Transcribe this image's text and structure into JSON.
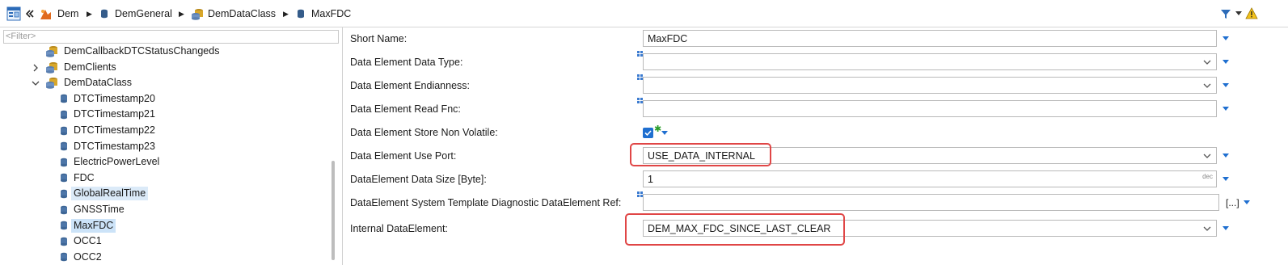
{
  "breadcrumb": {
    "items": [
      "Dem",
      "DemGeneral",
      "DemDataClass",
      "MaxFDC"
    ]
  },
  "filter": {
    "placeholder": "<Filter>"
  },
  "tree": [
    {
      "label": "DemCallbackDTCStatusChangeds",
      "icon": "folder-db-icon",
      "indent": 1,
      "expander": "",
      "state": ""
    },
    {
      "label": "DemClients",
      "icon": "folder-db-icon",
      "indent": 1,
      "expander": "collapsed",
      "state": ""
    },
    {
      "label": "DemDataClass",
      "icon": "folder-db-icon",
      "indent": 1,
      "expander": "expanded",
      "state": ""
    },
    {
      "label": "DTCTimestamp20",
      "icon": "db-icon",
      "indent": 2,
      "expander": "",
      "state": ""
    },
    {
      "label": "DTCTimestamp21",
      "icon": "db-icon",
      "indent": 2,
      "expander": "",
      "state": ""
    },
    {
      "label": "DTCTimestamp22",
      "icon": "db-icon",
      "indent": 2,
      "expander": "",
      "state": ""
    },
    {
      "label": "DTCTimestamp23",
      "icon": "db-icon",
      "indent": 2,
      "expander": "",
      "state": ""
    },
    {
      "label": "ElectricPowerLevel",
      "icon": "db-icon",
      "indent": 2,
      "expander": "",
      "state": ""
    },
    {
      "label": "FDC",
      "icon": "db-icon",
      "indent": 2,
      "expander": "",
      "state": ""
    },
    {
      "label": "GlobalRealTime",
      "icon": "db-icon",
      "indent": 2,
      "expander": "",
      "state": "hl"
    },
    {
      "label": "GNSSTime",
      "icon": "db-icon",
      "indent": 2,
      "expander": "",
      "state": ""
    },
    {
      "label": "MaxFDC",
      "icon": "db-icon",
      "indent": 2,
      "expander": "",
      "state": "sel"
    },
    {
      "label": "OCC1",
      "icon": "db-icon",
      "indent": 2,
      "expander": "",
      "state": ""
    },
    {
      "label": "OCC2",
      "icon": "db-icon",
      "indent": 2,
      "expander": "",
      "state": ""
    }
  ],
  "form": {
    "short_name_label": "Short Name:",
    "short_name_value": "MaxFDC",
    "data_type_label": "Data Element Data Type:",
    "data_type_value": "",
    "endianness_label": "Data Element Endianness:",
    "endianness_value": "",
    "read_fnc_label": "Data Element Read Fnc:",
    "read_fnc_value": "",
    "store_nv_label": "Data Element Store Non Volatile:",
    "store_nv_checked": true,
    "use_port_label": "Data Element Use Port:",
    "use_port_value": "USE_DATA_INTERNAL",
    "data_size_label": "DataElement Data Size [Byte]:",
    "data_size_value": "1",
    "data_size_unit": "dec",
    "sys_tmpl_label": "DataElement System Template Diagnostic DataElement Ref:",
    "sys_tmpl_value": "",
    "sys_tmpl_browse": "[...]",
    "internal_label": "Internal DataElement:",
    "internal_value": "DEM_MAX_FDC_SINCE_LAST_CLEAR"
  },
  "colors": {
    "highlight": "#e04646",
    "accent": "#1f6fd0",
    "selection": "#cce3f8"
  }
}
